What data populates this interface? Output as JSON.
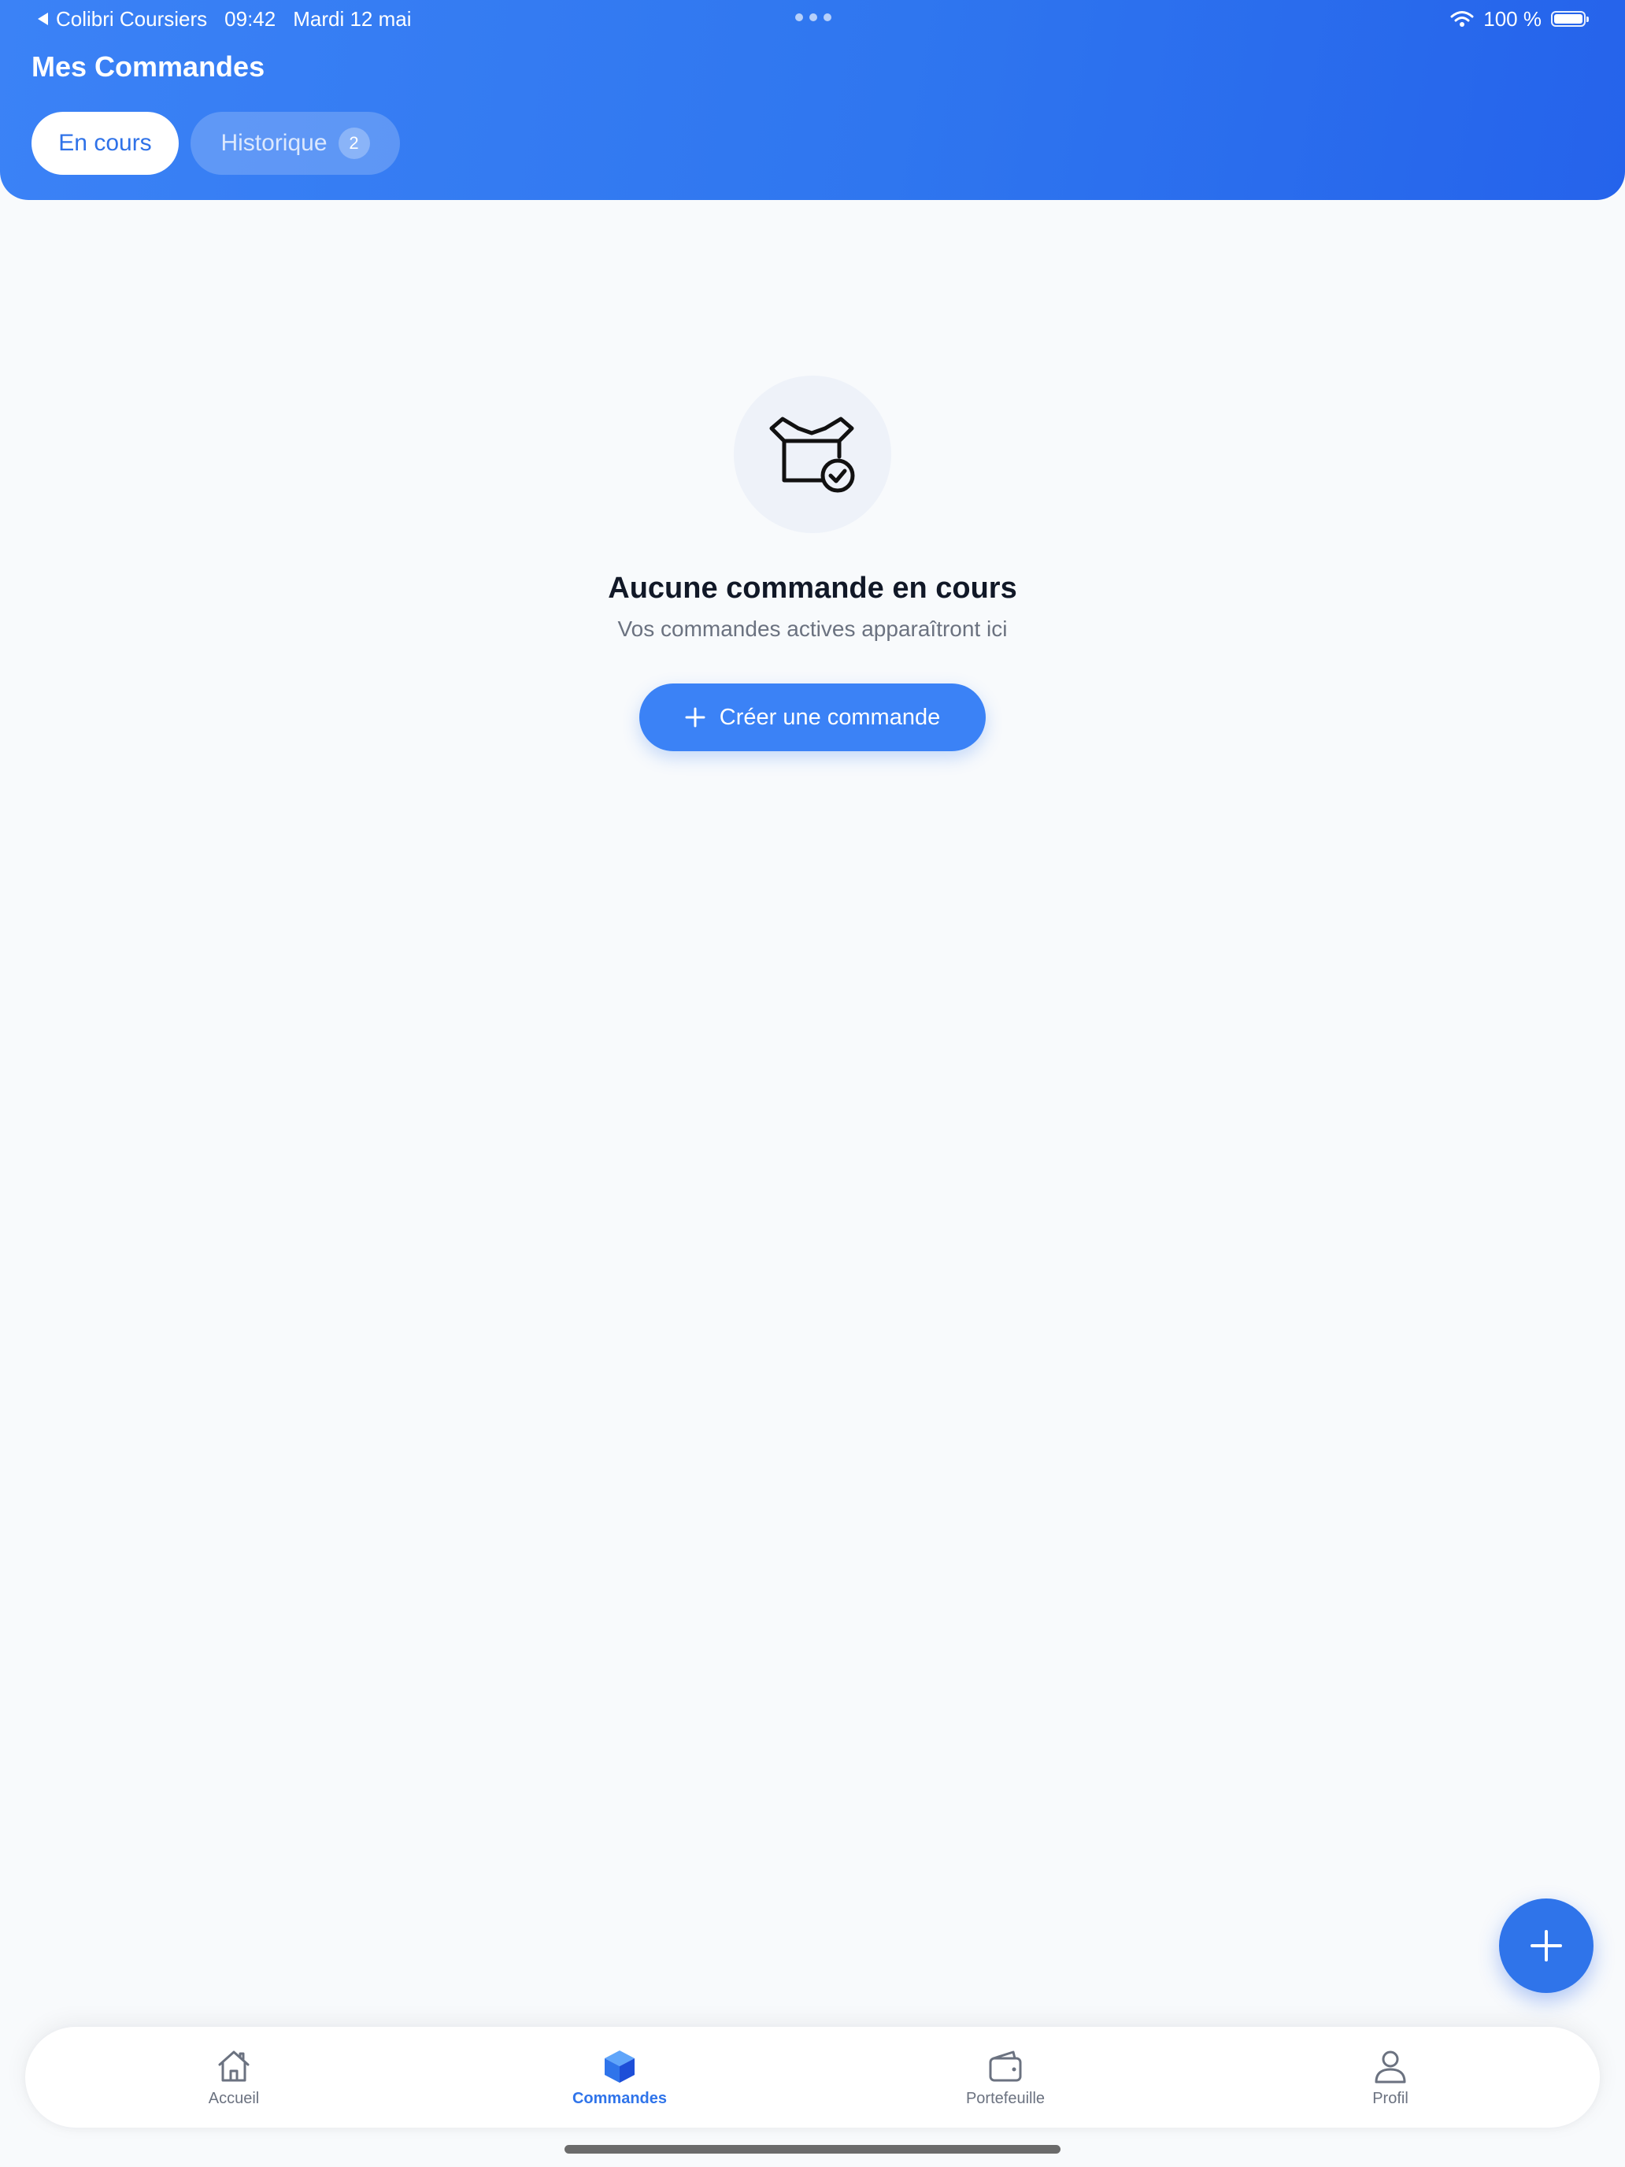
{
  "status_bar": {
    "back_app": "Colibri Coursiers",
    "time": "09:42",
    "date": "Mardi 12 mai",
    "battery": "100 %",
    "battery_level": 1.0
  },
  "header": {
    "title": "Mes Commandes",
    "tabs": [
      {
        "label": "En cours",
        "active": true
      },
      {
        "label": "Historique",
        "badge": "2",
        "active": false
      }
    ]
  },
  "empty_state": {
    "icon": "open-box-check-icon",
    "title": "Aucune commande en cours",
    "subtitle": "Vos commandes actives apparaîtront ici",
    "button_label": "Créer une commande"
  },
  "fab": {
    "icon": "plus-icon"
  },
  "bottom_nav": {
    "items": [
      {
        "label": "Accueil",
        "icon": "home-icon",
        "active": false
      },
      {
        "label": "Commandes",
        "icon": "box-icon",
        "active": true
      },
      {
        "label": "Portefeuille",
        "icon": "wallet-icon",
        "active": false
      },
      {
        "label": "Profil",
        "icon": "user-icon",
        "active": false
      }
    ]
  },
  "colors": {
    "primary": "#3b82f6",
    "primary_dark": "#2563eb",
    "background": "#f8fafc",
    "text_dark": "#111827",
    "text_muted": "#6b7280"
  }
}
